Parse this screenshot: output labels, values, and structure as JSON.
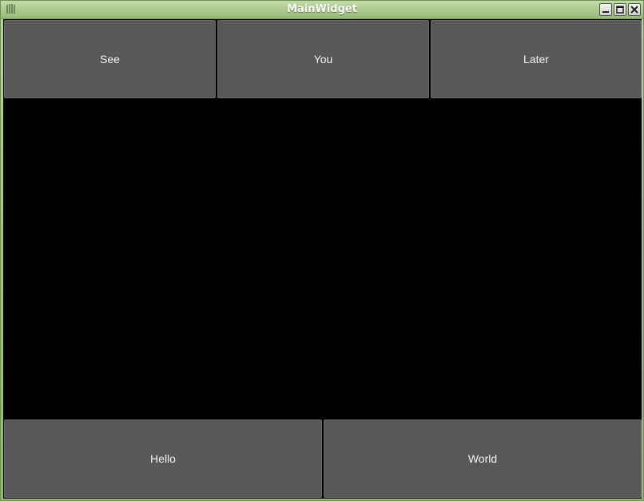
{
  "window": {
    "title": "MainWidget"
  },
  "title_icons": {
    "app": "app-grip-icon",
    "minimize": "minimize-icon",
    "maximize": "maximize-icon",
    "close": "close-icon"
  },
  "top_buttons": [
    {
      "label": "See"
    },
    {
      "label": "You"
    },
    {
      "label": "Later"
    }
  ],
  "bottom_buttons": [
    {
      "label": "Hello"
    },
    {
      "label": "World"
    }
  ],
  "colors": {
    "titlebar": "#a9c98c",
    "button": "#585858",
    "background": "#000000",
    "button_text": "#f2f2f2"
  }
}
